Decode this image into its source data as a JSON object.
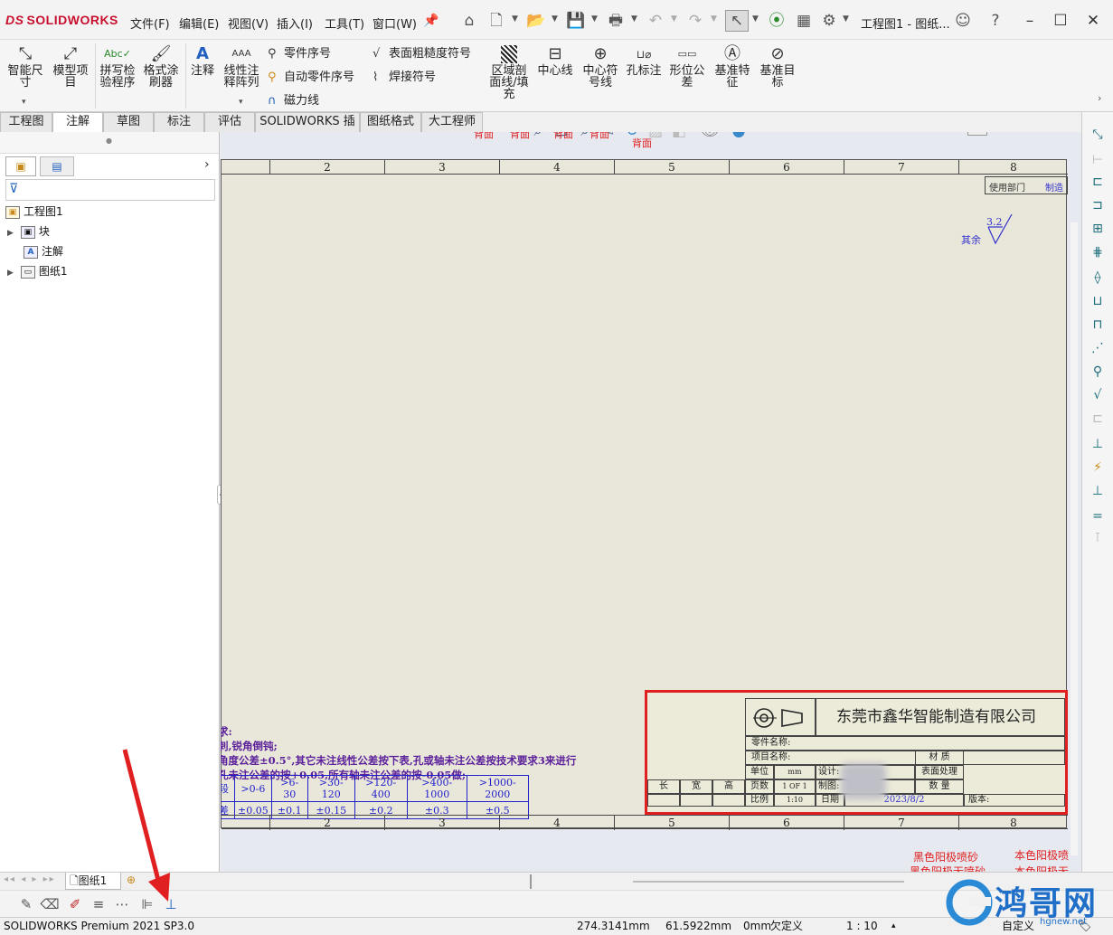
{
  "app": {
    "brand": "SOLIDWORKS",
    "brand_prefix": "DS",
    "doc_title": "工程图1 - 图纸..."
  },
  "menu": [
    "文件(F)",
    "编辑(E)",
    "视图(V)",
    "插入(I)",
    "工具(T)",
    "窗口(W)"
  ],
  "ribbon": {
    "smart_dim": "智能尺寸",
    "model_items": "模型项目",
    "spell_check": "拼写检验程序",
    "format_painter": "格式涂刷器",
    "note": "注释",
    "linear_pattern": "线性注释阵列",
    "balloon": "零件序号",
    "auto_balloon": "自动零件序号",
    "magnetic_line": "磁力线",
    "surface_finish": "表面粗糙度符号",
    "weld_symbol": "焊接符号",
    "area_hatch": "区域剖面线/填充",
    "centerline": "中心线",
    "center_mark": "中心符号线",
    "hole_callout": "孔标注",
    "gtol": "形位公差",
    "datum_feature": "基准特征",
    "datum_target": "基准目标"
  },
  "tabs": [
    "工程图",
    "注解",
    "草图",
    "标注",
    "评估",
    "SOLIDWORKS 插件",
    "图纸格式",
    "大工程师"
  ],
  "active_tab": 1,
  "tree": {
    "root": "工程图1",
    "items": [
      "块",
      "注解",
      "图纸1"
    ]
  },
  "view_labels": [
    "背面",
    "背面",
    "背面",
    "背面",
    "背面"
  ],
  "zones_top": [
    "2",
    "3",
    "4",
    "5",
    "6",
    "7",
    "8"
  ],
  "zones_bottom": [
    "2",
    "3",
    "4",
    "5",
    "6",
    "7",
    "8"
  ],
  "sheet": {
    "dept_label": "使用部门",
    "dept_value": "制造",
    "roughness_value": "3.2",
    "roughness_prefix": "其余",
    "req_lines": [
      "求:",
      "刺,锐角倒钝;",
      "角度公差±0.5°,其它未注线性公差按下表,孔或轴未注公差按技术要求3来进行",
      "孔未注公差的按+0.05,所有轴未注公差的按-0.05做;"
    ],
    "tol_header": [
      "段",
      ">0-6",
      ">6-30",
      ">30-120",
      ">120-400",
      ">400-1000",
      ">1000-2000"
    ],
    "tol_values": [
      "差",
      "±0.05",
      "±0.1",
      "±0.15",
      "±0.2",
      "±0.3",
      "±0.5"
    ],
    "company": "东莞市鑫华智能制造有限公司",
    "part_name": "零件名称:",
    "project_name": "项目名称:",
    "unit": "单位",
    "unit_value": "mm",
    "design": "设计:",
    "material": "材 质",
    "surface": "表面处理",
    "pages": "页数",
    "pages_value": "1 OF 1",
    "drawn": "制图:",
    "quantity": "数 量",
    "scale": "比例",
    "scale_value": "1:10",
    "date": "日期",
    "date_value": "2023/8/2",
    "version": "版本:",
    "dims": [
      "长",
      "宽",
      "高"
    ],
    "notes_right": [
      "黑色阳极喷砂",
      "本色阳极喷",
      "黑色阳极无喷砂",
      "本色阳极无"
    ]
  },
  "sheet_tab": "图纸1",
  "status": {
    "product": "SOLIDWORKS Premium 2021 SP3.0",
    "x": "274.3141mm",
    "y": "61.5922mm",
    "z": "0mm",
    "state": "欠定义",
    "scale": "1 : 10",
    "custom": "自定义"
  },
  "watermark": {
    "text": "鸿哥网",
    "url": "hgnew.net"
  },
  "colors": {
    "accent_red": "#e02020",
    "annotation_blue": "#3333cc"
  }
}
